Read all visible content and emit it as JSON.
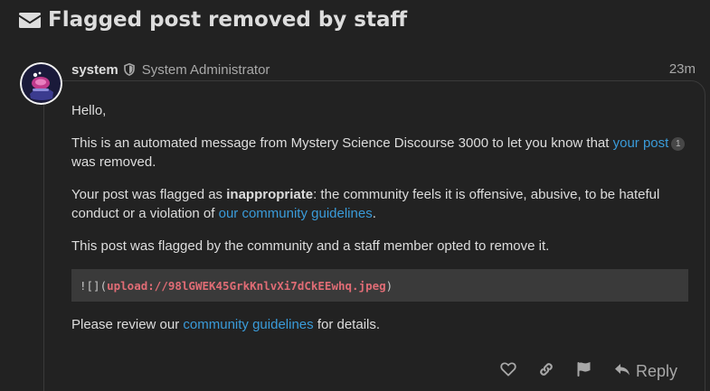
{
  "topic": {
    "title": "Flagged post removed by staff",
    "icon": "envelope-icon"
  },
  "post": {
    "username": "system",
    "user_icon": "shield-icon",
    "user_title": "System Administrator",
    "date": "23m",
    "body": {
      "greeting": "Hello,",
      "p1_text_a": "This is an automated message from Mystery Science Discourse 3000 to let you know that ",
      "p1_link": "your post",
      "p1_badge": "1",
      "p1_text_b": " was removed.",
      "p2_text_a": "Your post was flagged as ",
      "p2_strong": "inappropriate",
      "p2_text_b": ": the community feels it is offensive, abusive, to be hateful conduct or a violation of ",
      "p2_link": "our community guidelines",
      "p2_text_c": ".",
      "p3": "This post was flagged by the community and a staff member opted to remove it.",
      "code_prefix": "![](",
      "code_url": "upload://98lGWEK45GrkKnlvXi7dCkEEwhq.jpeg",
      "code_suffix": ")",
      "p4_text_a": "Please review our ",
      "p4_link": "community guidelines",
      "p4_text_b": " for details."
    },
    "actions": {
      "like_icon": "heart-icon",
      "link_icon": "link-icon",
      "flag_icon": "flag-icon",
      "reply_icon": "reply-icon",
      "reply_label": "Reply"
    }
  },
  "colors": {
    "background": "#222222",
    "text": "#dddddd",
    "muted": "#a8a8a8",
    "link": "#3a9bd9",
    "code_background": "#3a3a3a",
    "code_url": "#e06c75"
  }
}
